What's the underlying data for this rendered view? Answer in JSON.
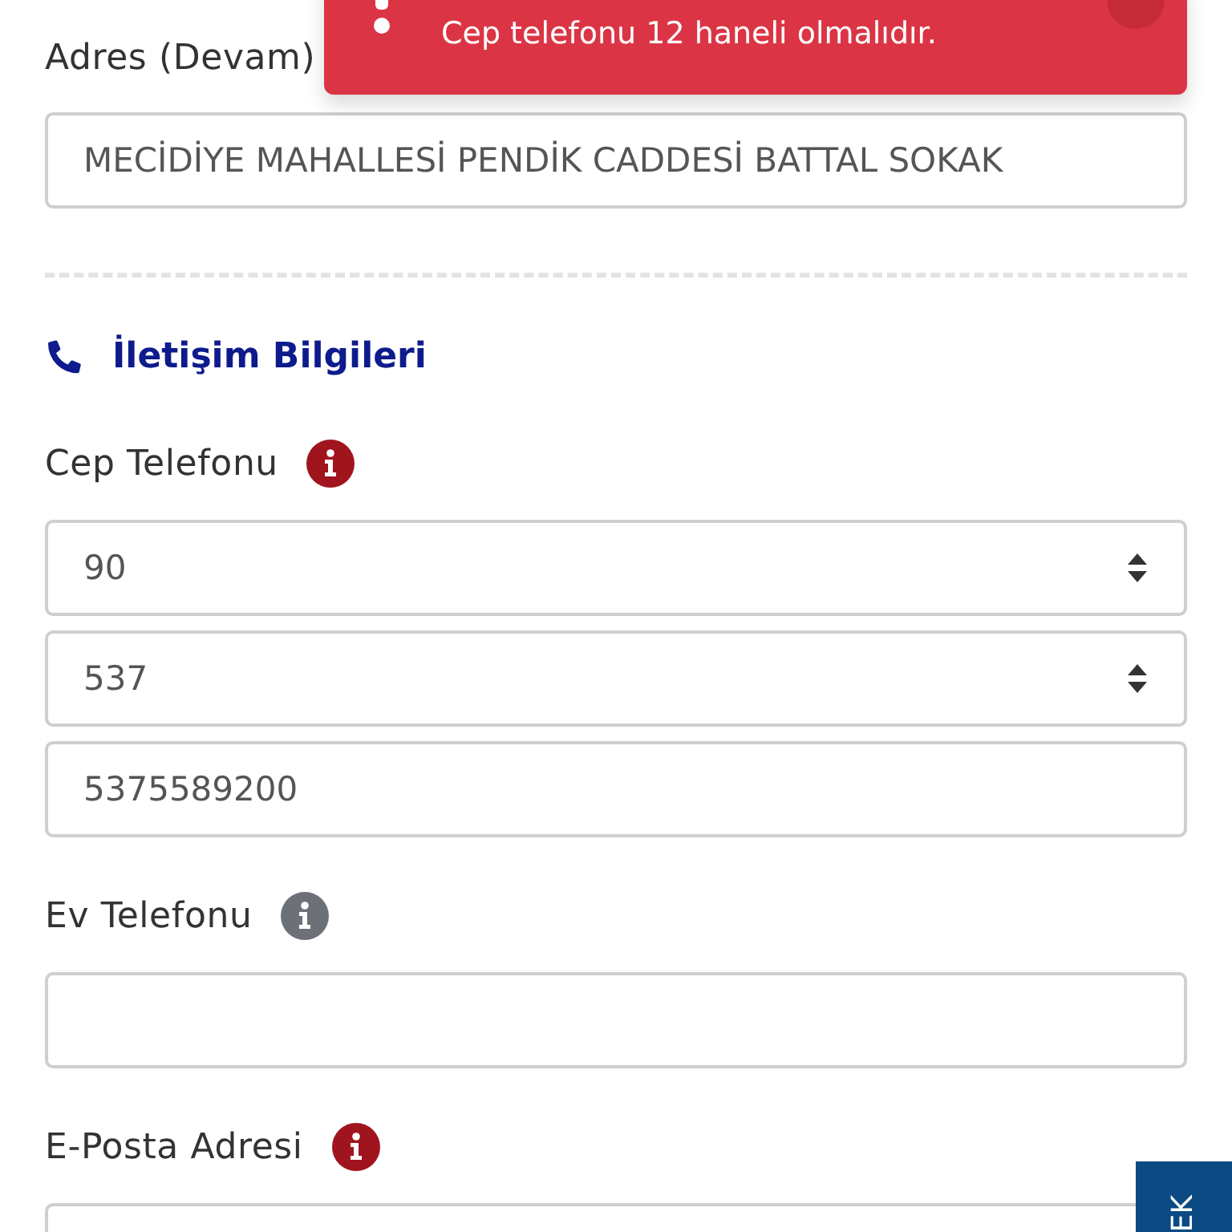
{
  "toast": {
    "message": "Cep telefonu 12 haneli olmalıdır."
  },
  "address_continued": {
    "label": "Adres (Devam)",
    "value": "MECİDİYE MAHALLESİ PENDİK CADDESİ BATTAL SOKAK"
  },
  "section": {
    "title": "İletişim Bilgileri"
  },
  "fields": [
    {
      "label": "Cep Telefonu",
      "required": true,
      "inputs": [
        {
          "kind": "select",
          "value": "90"
        },
        {
          "kind": "select",
          "value": "537"
        },
        {
          "kind": "text",
          "value": "5375589200"
        }
      ]
    },
    {
      "label": "Ev Telefonu",
      "required": false,
      "inputs": [
        {
          "kind": "text"
        }
      ]
    },
    {
      "label": "E-Posta Adresi",
      "required": true,
      "inputs": [
        {
          "kind": "text"
        }
      ]
    }
  ],
  "side_tab": {
    "label": "EK"
  }
}
